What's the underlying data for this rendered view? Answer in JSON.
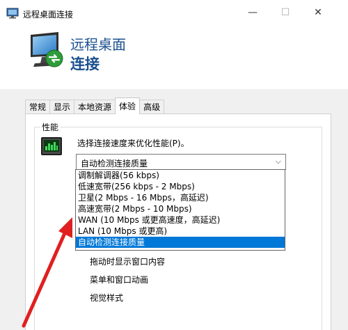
{
  "window": {
    "title": "远程桌面连接",
    "minimize_glyph": "—",
    "maximize_glyph": "☐",
    "close_glyph": "✕"
  },
  "header": {
    "line1": "远程桌面",
    "line2": "连接"
  },
  "tabs": [
    {
      "label": "常规",
      "active": false
    },
    {
      "label": "显示",
      "active": false
    },
    {
      "label": "本地资源",
      "active": false
    },
    {
      "label": "体验",
      "active": true
    },
    {
      "label": "高级",
      "active": false
    }
  ],
  "performance": {
    "group_title": "性能",
    "choose_label": "选择连接速度来优化性能(P)。",
    "combo_value": "自动检测连接质量",
    "combo_arrow": "⌵",
    "options": [
      "调制解调器(56 kbps)",
      "低速宽带(256 kbps - 2 Mbps)",
      "卫星(2 Mbps - 16 Mbps，高延迟)",
      "高速宽带(2 Mbps - 10 Mbps)",
      "WAN (10 Mbps 或更高速度，高延迟)",
      "LAN (10 Mbps 或更高)",
      "自动检测连接质量"
    ],
    "selected_option": "自动检测连接质量",
    "settings": [
      "拖动时显示窗口内容",
      "菜单和窗口动画",
      "视觉样式"
    ]
  },
  "colors": {
    "header_text": "#1a4f8f",
    "selection": "#0078d7",
    "annotation_arrow": "#e02020"
  },
  "icons": {
    "app": "remote-desktop-icon",
    "performance": "performance-monitor-icon",
    "annotation": "red-arrow-annotation"
  }
}
